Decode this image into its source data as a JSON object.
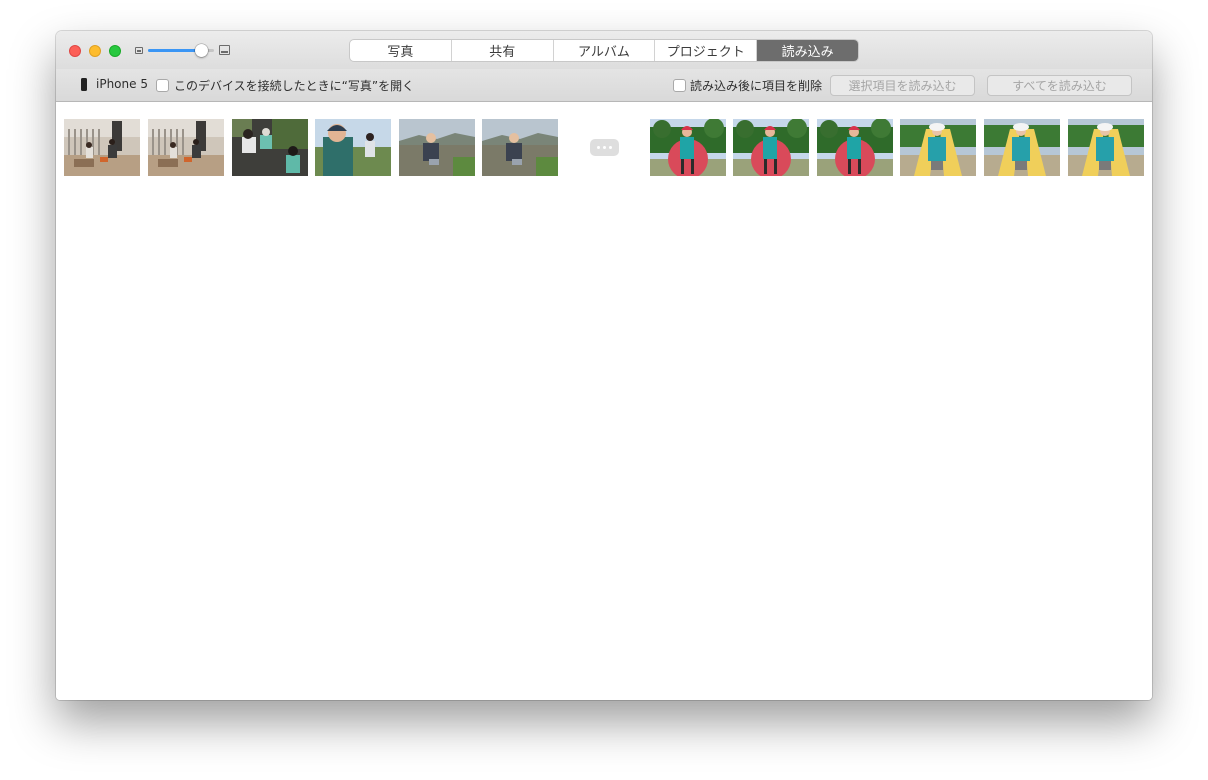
{
  "tabs": {
    "photos": "写真",
    "shared": "共有",
    "albums": "アルバム",
    "projects": "プロジェクト",
    "import": "読み込み",
    "active": "import"
  },
  "zoom": {
    "level": 0.88
  },
  "toolbar": {
    "device_name": "iPhone 5",
    "open_photos_label": "このデバイスを接続したときに“写真”を開く",
    "delete_after_import_label": "読み込み後に項目を削除",
    "import_selected_label": "選択項目を読み込む",
    "import_all_label": "すべてを読み込む"
  },
  "colors": {
    "close": "#fc5f57",
    "minimize": "#fdbc2e",
    "zoom": "#28c83f",
    "accent": "#3b96f5",
    "active_tab": "#6d6d6d"
  },
  "thumbnails": [
    {
      "scene": "sandbox-fence"
    },
    {
      "scene": "sandbox-fence"
    },
    {
      "scene": "kids-crouching"
    },
    {
      "scene": "boy-closeup"
    },
    {
      "scene": "boy-field"
    },
    {
      "scene": "boy-field"
    },
    {
      "scene": "red-swing"
    },
    {
      "scene": "red-swing"
    },
    {
      "scene": "red-swing"
    },
    {
      "scene": "slide-hat"
    },
    {
      "scene": "slide-hat"
    },
    {
      "scene": "slide-hat"
    }
  ]
}
